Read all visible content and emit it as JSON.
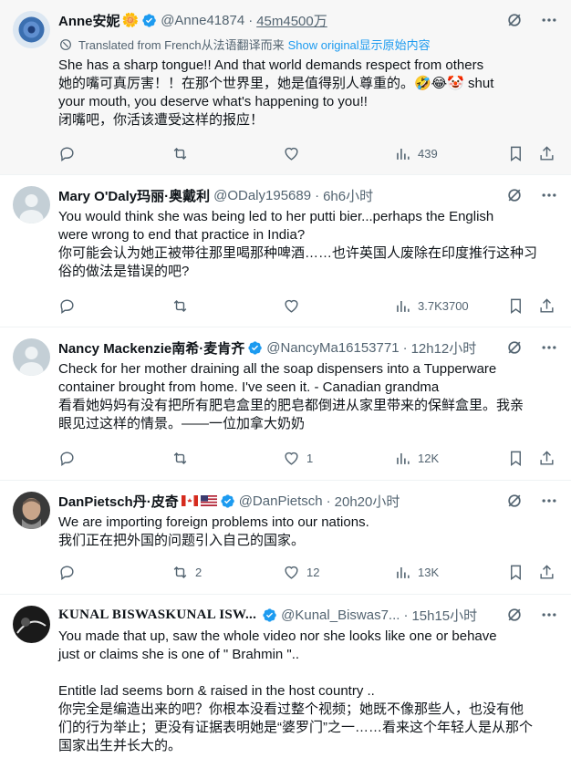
{
  "tweets": [
    {
      "name": "Anne安妮",
      "name_emoji": "🌼",
      "handle": "@Anne41874",
      "time": "45m4500万",
      "translated_text": "Translated from French从法语翻译而来",
      "show_original": "Show original显示原始内容",
      "text": "She has a sharp tongue!! And that world demands respect from others\n她的嘴可真厉害！！在那个世界里，她是值得别人尊重的。🤣😂🤡 shut\nyour mouth, you deserve what's happening to you!!\n闭嘴吧，你活该遭受这样的报应！",
      "replies": "",
      "retweets": "",
      "likes": "",
      "views": "439",
      "avatar_color": "#3b6fb0"
    },
    {
      "name": "Mary O'Daly玛丽·奥戴利",
      "handle": "@ODaly195689",
      "time": "6h6小时",
      "text": "You would think she was being led to her putti bier...perhaps the English\nwere wrong to end that practice in India?\n你可能会认为她正被带往那里喝那种啤酒……也许英国人废除在印度推行这种习\n俗的做法是错误的吧?",
      "replies": "",
      "retweets": "",
      "likes": "",
      "views": "3.7K3700",
      "avatar_color": "#c4cfd6"
    },
    {
      "name": "Nancy Mackenzie南希·麦肯齐",
      "handle": "@NancyMa16153771",
      "time": "12h12小时",
      "text": "Check for her mother draining all the soap dispensers into a Tupperware\ncontainer brought from home. I've seen it. - Canadian grandma\n看看她妈妈有没有把所有肥皂盒里的肥皂都倒进从家里带来的保鲜盒里。我亲\n眼见过这样的情景。——一位加拿大奶奶",
      "replies": "",
      "retweets": "",
      "likes": "1",
      "views": "12K",
      "avatar_color": "#c4cfd6"
    },
    {
      "name": "DanPietsch丹·皮奇",
      "handle": "@DanPietsch",
      "time": "20h20小时",
      "text": "We are importing foreign problems into our nations.\n我们正在把外国的问题引入自己的国家。",
      "replies": "",
      "retweets": "2",
      "likes": "12",
      "views": "13K",
      "avatar_color": "#6b5a4e"
    },
    {
      "name": "KUNAL BISWASKUNAL ISW...",
      "handle": "@Kunal_Biswas7...",
      "time": "15h15小时",
      "text": "You made that up, saw the whole video nor she looks like one or behave\njust or claims she is one of \" Brahmin \"..\n\nEntitle lad seems born & raised in the host country ..\n你完全是编造出来的吧？你根本没看过整个视频；她既不像那些人，也没有他\n们的行为举止；更没有证据表明她是“婆罗门”之一……看来这个年轻人是从那个\n国家出生并长大的。",
      "avatar_color": "#1a1a1a"
    }
  ],
  "colors": {
    "accent": "#1d9bf0",
    "secondary_text": "#536471",
    "verified_badge": "#1d9bf0"
  }
}
